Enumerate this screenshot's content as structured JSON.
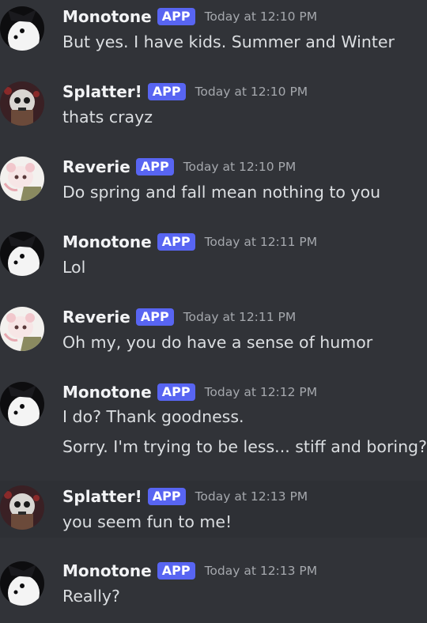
{
  "badge_label": "APP",
  "colors": {
    "background": "#313338",
    "highlight_row": "#2e3035",
    "badge": "#5865f2",
    "username": "#f2f3f5",
    "timestamp": "#a5a8ad",
    "text": "#dbdee1"
  },
  "messages": [
    {
      "author": "Monotone",
      "avatar_icon": "monotone-avatar-icon",
      "timestamp": "Today at 12:10 PM",
      "lines": [
        "But yes. I have kids. Summer and Winter"
      ]
    },
    {
      "author": "Splatter!",
      "avatar_icon": "splatter-avatar-icon",
      "timestamp": "Today at 12:10 PM",
      "lines": [
        "thats crayz"
      ]
    },
    {
      "author": "Reverie",
      "avatar_icon": "reverie-avatar-icon",
      "timestamp": "Today at 12:10 PM",
      "lines": [
        "Do spring and fall mean nothing to you"
      ]
    },
    {
      "author": "Monotone",
      "avatar_icon": "monotone-avatar-icon",
      "timestamp": "Today at 12:11 PM",
      "lines": [
        "Lol"
      ]
    },
    {
      "author": "Reverie",
      "avatar_icon": "reverie-avatar-icon",
      "timestamp": "Today at 12:11 PM",
      "lines": [
        "Oh my, you do have a sense of humor"
      ]
    },
    {
      "author": "Monotone",
      "avatar_icon": "monotone-avatar-icon",
      "timestamp": "Today at 12:12 PM",
      "lines": [
        "I do? Thank goodness.",
        "Sorry. I'm trying to be less... stiff and boring?"
      ]
    },
    {
      "author": "Splatter!",
      "avatar_icon": "splatter-avatar-icon",
      "timestamp": "Today at 12:13 PM",
      "lines": [
        "you seem fun to me!"
      ]
    },
    {
      "author": "Monotone",
      "avatar_icon": "monotone-avatar-icon",
      "timestamp": "Today at 12:13 PM",
      "lines": [
        "Really?"
      ]
    }
  ]
}
